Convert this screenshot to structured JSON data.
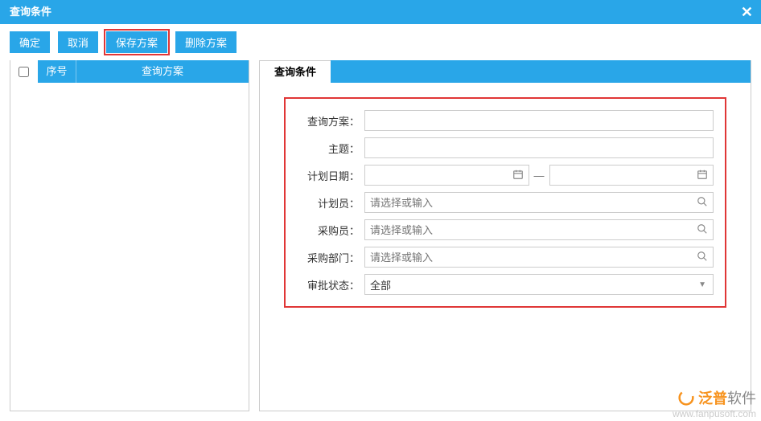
{
  "header": {
    "title": "查询条件"
  },
  "toolbar": {
    "ok_label": "确定",
    "cancel_label": "取消",
    "save_scheme_label": "保存方案",
    "delete_scheme_label": "删除方案"
  },
  "left": {
    "col_num": "序号",
    "col_scheme": "查询方案"
  },
  "right": {
    "tab_label": "查询条件",
    "fields": {
      "scheme_label": "查询方案：",
      "subject_label": "主题：",
      "plan_date_label": "计划日期：",
      "date_sep": "—",
      "planner_label": "计划员：",
      "planner_placeholder": "请选择或输入",
      "buyer_label": "采购员：",
      "buyer_placeholder": "请选择或输入",
      "dept_label": "采购部门：",
      "dept_placeholder": "请选择或输入",
      "approval_label": "审批状态：",
      "approval_value": "全部"
    }
  },
  "watermark": {
    "brand1": "泛普",
    "brand2": "软件",
    "url": "www.fanpusoft.com"
  },
  "icons": {
    "calendar": "📅",
    "search": "🔍"
  }
}
